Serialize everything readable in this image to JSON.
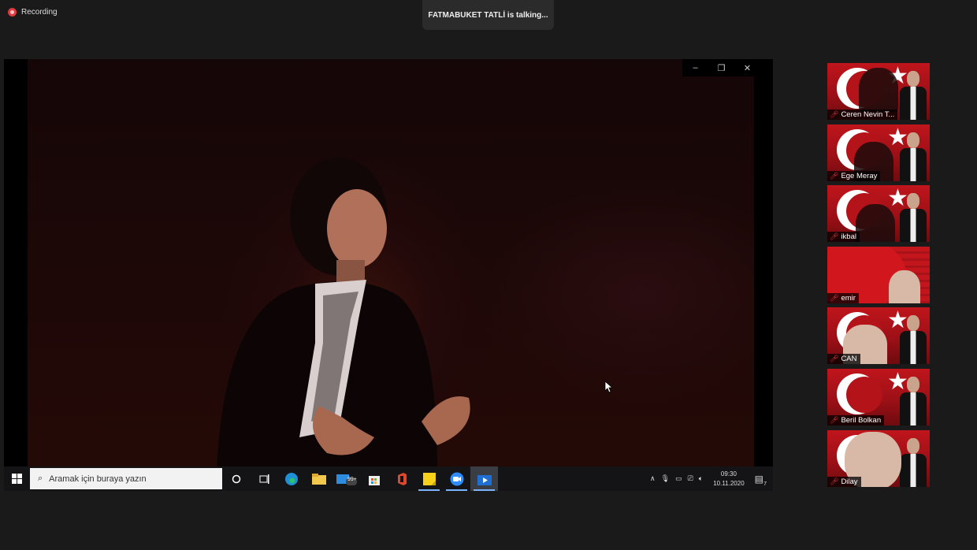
{
  "recording": {
    "label": "Recording"
  },
  "talking_banner": "FATMABUKET TATLİ is talking...",
  "window_controls": [
    "–",
    "❐",
    "✕"
  ],
  "taskbar": {
    "search_placeholder": "Aramak için buraya yazın",
    "mail_badge": "99+",
    "clock_time": "09:30",
    "clock_date": "10.11.2020",
    "notification_count": "7"
  },
  "participants": [
    {
      "name": "Ceren Nevin T...",
      "muted": true
    },
    {
      "name": "Ege Meray",
      "muted": true
    },
    {
      "name": "ikbal",
      "muted": true
    },
    {
      "name": "emir",
      "muted": true
    },
    {
      "name": "CAN",
      "muted": true
    },
    {
      "name": "Beril Bolkan",
      "muted": true
    },
    {
      "name": "Dilay",
      "muted": true
    }
  ],
  "colors": {
    "mute_red": "#e0393e",
    "flag_red": "#c0151c",
    "taskbar": "#141417"
  }
}
